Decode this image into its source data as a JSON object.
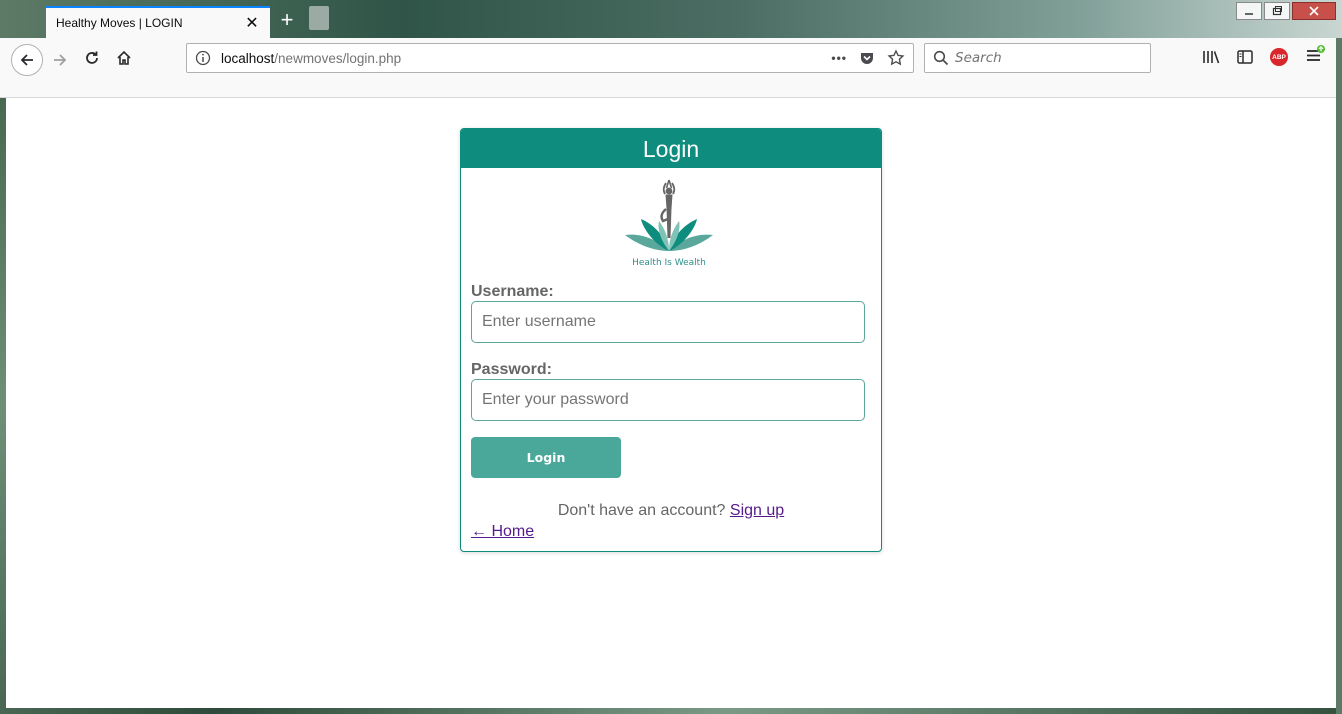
{
  "browser": {
    "tab_title": "Healthy Moves | LOGIN",
    "tab_close": "✕",
    "new_tab": "+",
    "url_host": "localhost",
    "url_path": "/newmoves/login.php",
    "url_more": "•••",
    "search_placeholder": "Search",
    "abp_label": "ABP"
  },
  "login": {
    "header": "Login",
    "logo_caption": "Health Is Wealth",
    "username_label": "Username:",
    "username_placeholder": "Enter username",
    "username_value": "",
    "password_label": "Password:",
    "password_placeholder": "Enter your password",
    "password_value": "",
    "button_label": "Login",
    "signup_prompt": "Don't have an account?",
    "signup_link": "Sign up",
    "home_link": "← Home"
  },
  "colors": {
    "brand_teal": "#0e8c7d",
    "button_teal": "#4aa89a",
    "link_visited": "#551a8b"
  }
}
